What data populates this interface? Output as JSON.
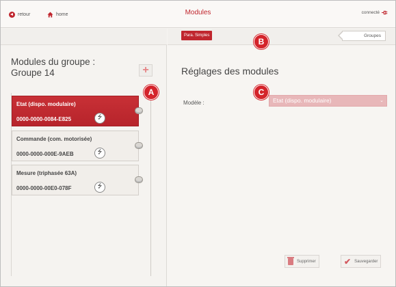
{
  "header": {
    "back_label": "retour",
    "home_label": "home",
    "title": "Modules",
    "connection_label": "connecté"
  },
  "tabs": {
    "simple_label": "Para. Simples",
    "groups_label": "Groupes"
  },
  "group_panel": {
    "title_line1": "Modules du groupe :",
    "title_line2": "Groupe 14",
    "add_symbol": "+"
  },
  "modules": [
    {
      "name": "Etat (dispo. modulaire)",
      "serial": "0000-0000-0084-E825",
      "active": true
    },
    {
      "name": "Commande (com. motorisée)",
      "serial": "0000-0000-000E-9AEB",
      "active": false
    },
    {
      "name": "Mesure (triphasée 63A)",
      "serial": "0000-0000-00E0-078F",
      "active": false
    }
  ],
  "settings": {
    "title": "Réglages des modules",
    "model_label": "Modèle :",
    "model_value": "Etat (dispo. modulaire)"
  },
  "actions": {
    "delete_label": "Supprimer",
    "save_label": "Sauvegarder"
  },
  "badges": {
    "a": "A",
    "b": "B",
    "c": "C"
  },
  "colors": {
    "accent": "#c0262e",
    "accent_light": "#e8b7b9",
    "background": "#f7f5f2"
  },
  "icons": {
    "usb": "usb-icon",
    "back": "back-arrow-icon",
    "home": "home-icon",
    "connection": "plug-icon",
    "delete": "trash-icon",
    "save": "checkmark-icon"
  }
}
